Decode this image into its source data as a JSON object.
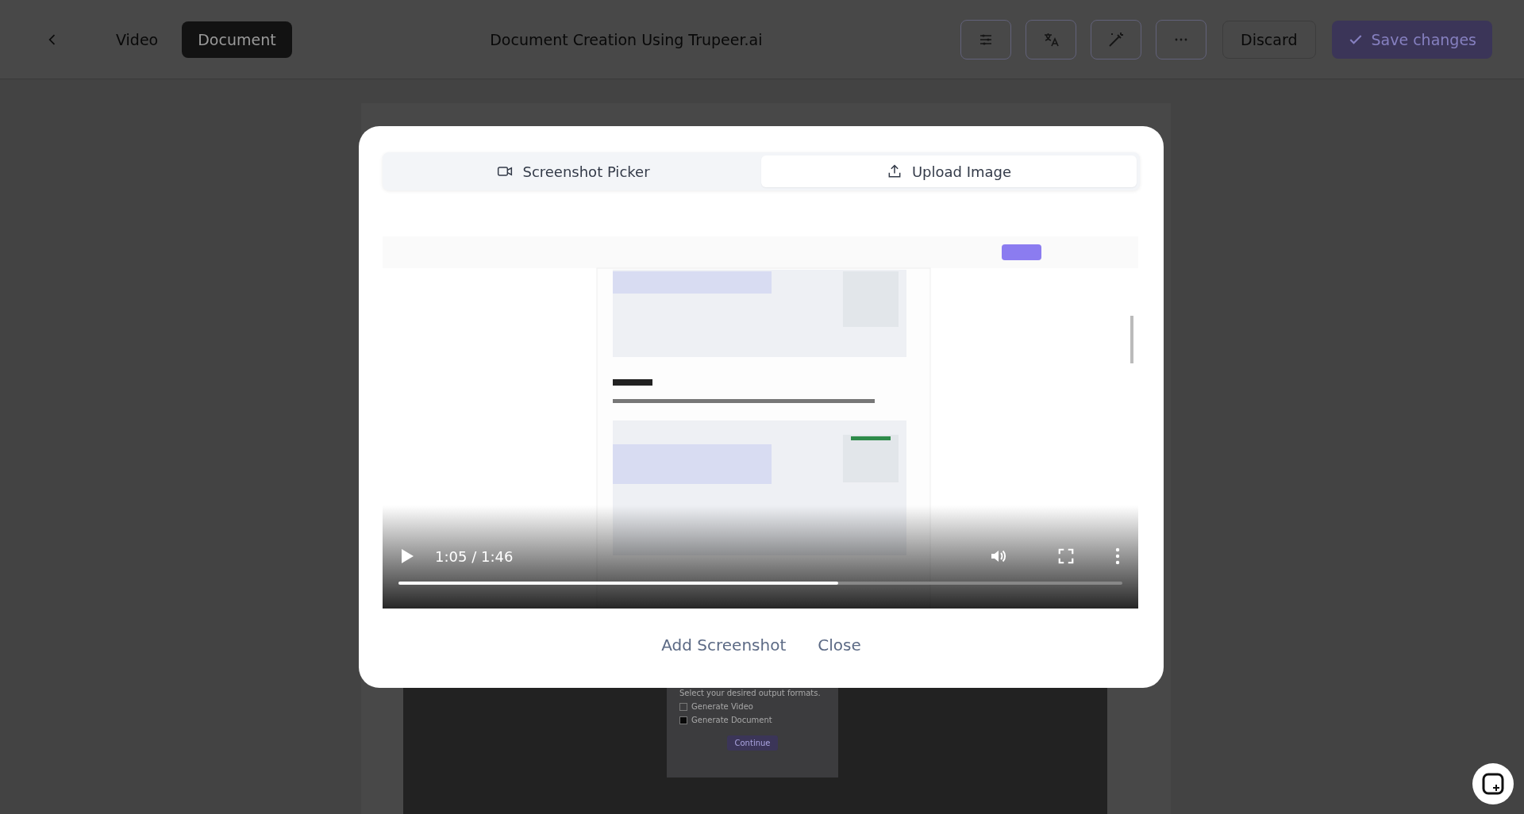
{
  "top_bar": {
    "view_tabs": [
      {
        "label": "Video",
        "selected": false
      },
      {
        "label": "Document",
        "selected": true
      }
    ],
    "title": "Document Creation Using Trupeer.ai",
    "discard": "Discard",
    "save": "Save changes"
  },
  "background_dialog": {
    "prompt": "Select your desired output formats.",
    "options": [
      {
        "label": "Generate Video",
        "checked": false
      },
      {
        "label": "Generate Document",
        "checked": true
      }
    ],
    "button": "Continue"
  },
  "modal": {
    "tabs": [
      {
        "label": "Screenshot Picker",
        "selected": false
      },
      {
        "label": "Upload Image",
        "selected": true
      }
    ],
    "video": {
      "kind": "picture",
      "time": "1:05 / 1:46",
      "level": 0.607
    },
    "buttons": [
      "Add Screenshot",
      "Close"
    ]
  }
}
